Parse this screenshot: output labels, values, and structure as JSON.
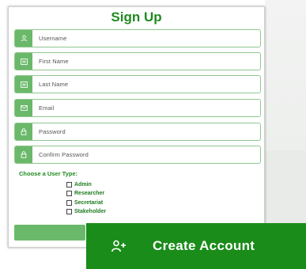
{
  "form": {
    "title": "Sign Up",
    "fields": [
      {
        "placeholder": "Username",
        "icon": "user-icon"
      },
      {
        "placeholder": "First Name",
        "icon": "id-card-icon"
      },
      {
        "placeholder": "Last Name",
        "icon": "id-card-icon"
      },
      {
        "placeholder": "Email",
        "icon": "envelope-icon"
      },
      {
        "placeholder": "Password",
        "icon": "lock-icon"
      },
      {
        "placeholder": "Confirm Password",
        "icon": "lock-icon"
      }
    ],
    "user_type_label": "Choose a User Type:",
    "user_types": [
      "Admin",
      "Researcher",
      "Secretariat",
      "Stakeholder"
    ]
  },
  "create_account": {
    "label": "Create Account",
    "icon": "user-plus-icon"
  },
  "colors": {
    "accent": "#1a8c1a",
    "icon_bg": "#6ab96a",
    "field_border": "#8fc68f"
  }
}
